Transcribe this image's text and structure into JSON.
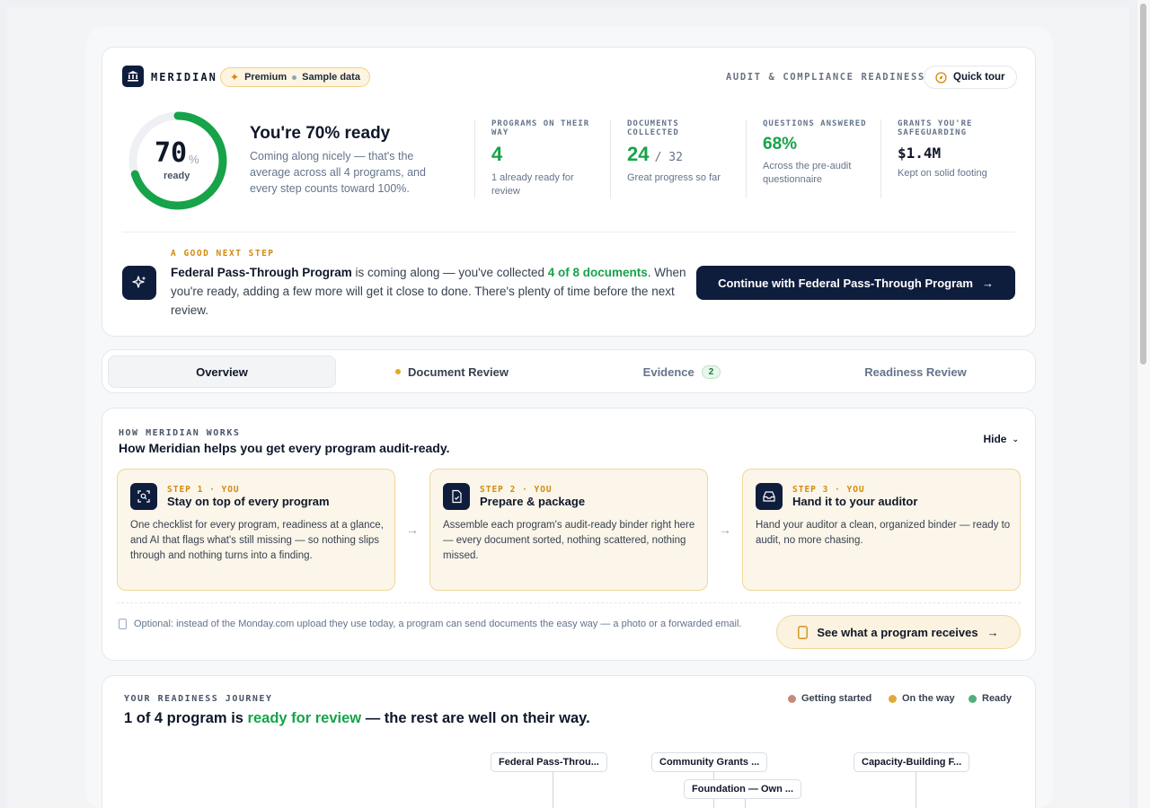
{
  "brand": {
    "name": "MERIDIAN",
    "badge": "Premium",
    "badge_suffix": "Sample data"
  },
  "header": {
    "audit_label": "AUDIT & COMPLIANCE READINESS",
    "quick_tour": "Quick tour"
  },
  "readiness": {
    "percent": 70,
    "percent_text": "70",
    "percent_sign": "%",
    "ring_label": "ready",
    "title": "You're 70% ready",
    "description": "Coming along nicely — that's the average across all 4 programs, and every step counts toward 100%."
  },
  "stats": [
    {
      "label": "PROGRAMS ON THEIR WAY",
      "value": "4",
      "suffix": "",
      "note": "1 already ready for review"
    },
    {
      "label": "DOCUMENTS COLLECTED",
      "value": "24",
      "suffix": "/ 32",
      "note": "Great progress so far"
    },
    {
      "label": "QUESTIONS ANSWERED",
      "value": "68%",
      "suffix": "",
      "note": "Across the pre-audit questionnaire"
    },
    {
      "label": "GRANTS YOU'RE SAFEGUARDING",
      "value": "$1.4M",
      "suffix": "",
      "note": "Kept on solid footing"
    }
  ],
  "next_step": {
    "label": "A GOOD NEXT STEP",
    "program": "Federal Pass-Through Program",
    "text_a": " is coming along — you've collected ",
    "highlight": "4 of 8 documents",
    "text_b": ". When you're ready, adding a few more will get it close to done. There's plenty of time before the next review.",
    "cta": "Continue with Federal Pass-Through Program"
  },
  "tabs": [
    {
      "label": "Overview"
    },
    {
      "label": "Document Review"
    },
    {
      "label": "Evidence",
      "badge": "2"
    },
    {
      "label": "Readiness Review"
    }
  ],
  "how": {
    "label": "HOW MERIDIAN WORKS",
    "title": "How Meridian helps you get every program audit-ready.",
    "hide": "Hide",
    "steps": [
      {
        "kicker": "STEP 1 · YOU",
        "title": "Stay on top of every program",
        "desc": "One checklist for every program, readiness at a glance, and AI that flags what's still missing — so nothing slips through and nothing turns into a finding.",
        "icon": "scan-icon"
      },
      {
        "kicker": "STEP 2 · YOU",
        "title": "Prepare & package",
        "desc": "Assemble each program's audit-ready binder right here — every document sorted, nothing scattered, nothing missed.",
        "icon": "file-check-icon"
      },
      {
        "kicker": "STEP 3 · YOU",
        "title": "Hand it to your auditor",
        "desc": "Hand your auditor a clean, organized binder — ready to audit, no more chasing.",
        "icon": "inbox-icon"
      }
    ],
    "optional_text": "Optional: instead of the Monday.com upload they use today, a program can send documents the easy way — a photo or a forwarded email.",
    "receive_button": "See what a program receives"
  },
  "journey": {
    "label": "YOUR READINESS JOURNEY",
    "title_a": "1 of 4 program is ",
    "title_highlight": "ready for review",
    "title_b": " — the rest are well on their way.",
    "legend": [
      {
        "label": "Getting started",
        "color": "#c58a7c"
      },
      {
        "label": "On the way",
        "color": "#e0a93a"
      },
      {
        "label": "Ready",
        "color": "#4fb07a"
      }
    ],
    "programs": [
      {
        "name": "Federal Pass-Throu..."
      },
      {
        "name": "Community Grants ..."
      },
      {
        "name": "Foundation — Own ..."
      },
      {
        "name": "Capacity-Building F..."
      }
    ]
  },
  "colors": {
    "navy": "#0f1d3d",
    "green": "#16a34a",
    "amber": "#d28a0f"
  }
}
